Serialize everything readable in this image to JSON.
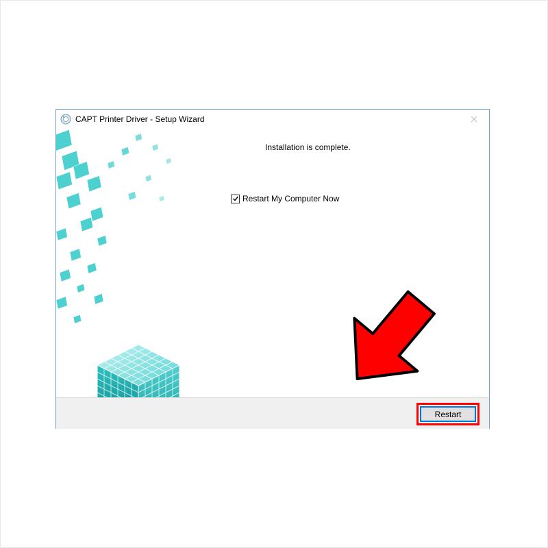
{
  "dialog": {
    "title": "CAPT Printer Driver - Setup Wizard",
    "status_message": "Installation is complete.",
    "checkbox_label": "Restart My Computer Now",
    "checkbox_checked": true,
    "restart_button_label": "Restart"
  },
  "colors": {
    "dialog_border": "#6fa3d8",
    "button_focus": "#0078d7",
    "annotation": "#ff0000",
    "graphic_teal_light": "#9de8e8",
    "graphic_teal_mid": "#3dcccc",
    "graphic_teal_dark": "#0b9b9b"
  }
}
